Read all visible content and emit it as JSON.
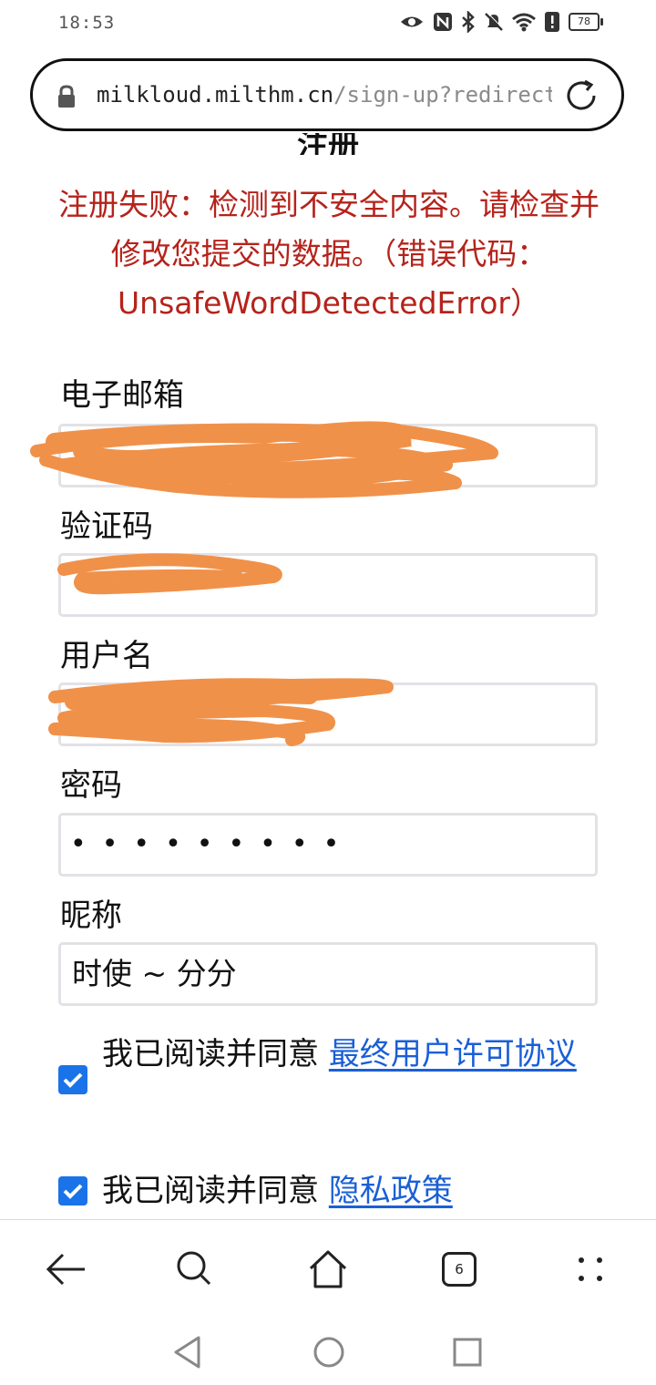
{
  "status_bar": {
    "time": "18:53",
    "battery": "78",
    "icons": [
      "eye-icon",
      "nfc-icon",
      "bluetooth-icon",
      "mute-icon",
      "wifi-icon",
      "alert-icon",
      "battery-icon"
    ]
  },
  "url_bar": {
    "host": "milkloud.milthm.cn",
    "path": "/sign-up?redirect"
  },
  "page": {
    "heading": "注册",
    "error": "注册失败：检测到不安全内容。请检查并修改您提交的数据。（错误代码：UnsafeWordDetectedError）"
  },
  "form": {
    "email": {
      "label": "电子邮箱",
      "value": ""
    },
    "code": {
      "label": "验证码",
      "value": ""
    },
    "username": {
      "label": "用户名",
      "value": ""
    },
    "password": {
      "label": "密码",
      "value": "•••••••••"
    },
    "nickname": {
      "label": "昵称",
      "value": "时使 ~ 分分"
    }
  },
  "agreements": [
    {
      "text": "我已阅读并同意 ",
      "link": "最终用户许可协议",
      "checked": true
    },
    {
      "text": "我已阅读并同意 ",
      "link": "隐私政策",
      "checked": true
    }
  ],
  "browser_bar": {
    "tab_count": "6"
  },
  "colors": {
    "error": "#b5231b",
    "link": "#1a5fd6",
    "checkbox": "#1a73e8",
    "scribble": "#f0914a"
  }
}
